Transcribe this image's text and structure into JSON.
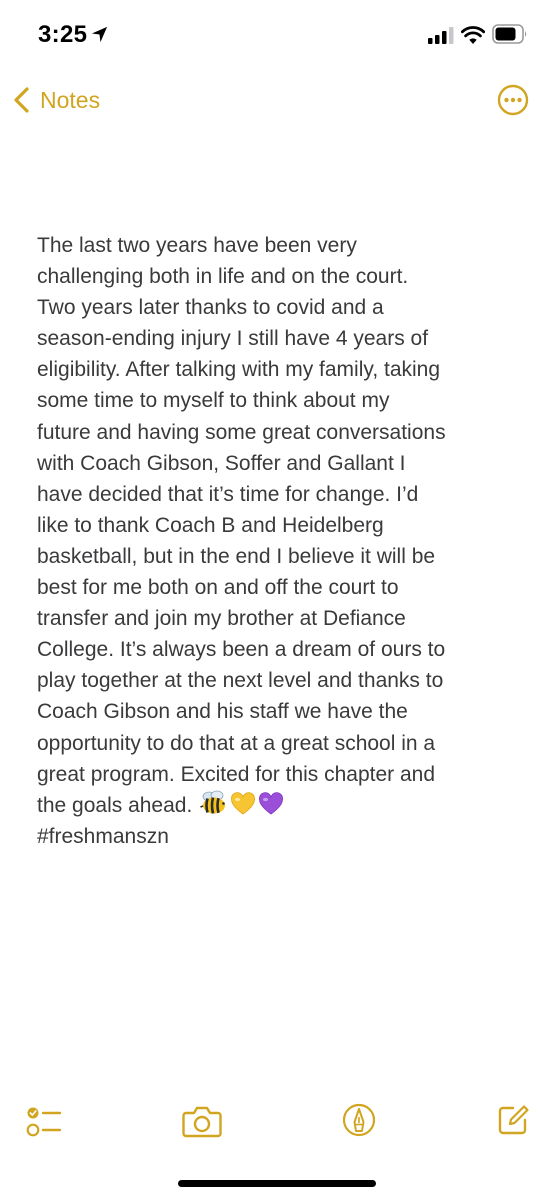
{
  "status_bar": {
    "time": "3:25",
    "icons": [
      "location-arrow-icon",
      "cellular-signal-icon",
      "wifi-icon",
      "battery-icon"
    ]
  },
  "nav": {
    "back_label": "Notes",
    "more_icon": "ellipsis-circle-icon"
  },
  "note": {
    "text": "The last two years have been very\nchallenging both in life and on the court.\nTwo years later thanks to covid and a\nseason-ending injury I still have 4 years of\neligibility. After talking with my family, taking\nsome time to myself to think about my\nfuture and having some great conversations\nwith Coach Gibson, Soffer and Gallant I\nhave decided that it’s time for change. I’d\nlike to thank Coach B and Heidelberg\nbasketball, but in the end I believe it will be\nbest for me both on and off the court to\ntransfer and join my brother at Defiance\nCollege. It’s always been a dream of ours to\nplay together at the next level and thanks to\nCoach Gibson and his staff we have the\nopportunity to do that at a great school in a\ngreat program. Excited for this chapter and\nthe goals ahead. ",
    "emojis": [
      "bee-emoji",
      "yellow-heart-emoji",
      "purple-heart-emoji"
    ],
    "hashtag": "#freshmanszn"
  },
  "toolbar": {
    "items": [
      "checklist-icon",
      "camera-icon",
      "markup-pen-icon",
      "compose-icon"
    ]
  },
  "colors": {
    "accent": "#d2a520",
    "text": "#3a3a3c",
    "background": "#ffffff"
  }
}
